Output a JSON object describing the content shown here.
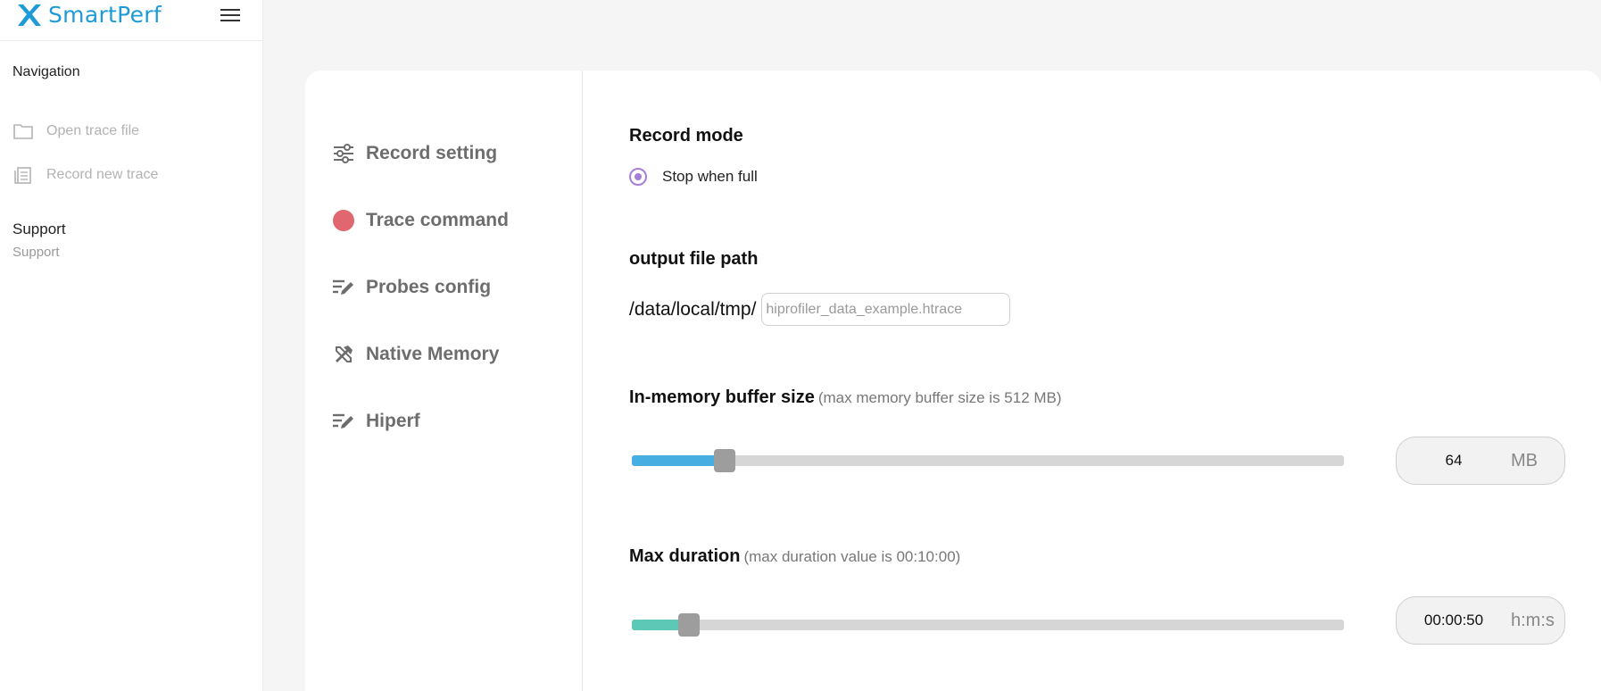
{
  "app": {
    "logo_text": "SmartPerf"
  },
  "sidebar": {
    "navigation_title": "Navigation",
    "items": [
      {
        "label": "Open trace file",
        "icon": "folder-icon"
      },
      {
        "label": "Record new trace",
        "icon": "copy-icon"
      }
    ],
    "support_title": "Support",
    "support_sub": "Support"
  },
  "settings_menu": [
    {
      "label": "Record setting",
      "icon": "sliders-icon"
    },
    {
      "label": "Trace command",
      "icon": "record-dot-icon"
    },
    {
      "label": "Probes config",
      "icon": "edit-icon"
    },
    {
      "label": "Native Memory",
      "icon": "tools-icon"
    },
    {
      "label": "Hiperf",
      "icon": "edit-icon"
    }
  ],
  "record_mode": {
    "title": "Record mode",
    "option_label": "Stop when full",
    "selected": true
  },
  "output_path": {
    "title": "output file path",
    "prefix": "/data/local/tmp/",
    "placeholder": "hiprofiler_data_example.htrace"
  },
  "buffer_size": {
    "title": "In-memory buffer size",
    "note": "(max memory buffer size is 512 MB)",
    "value": "64",
    "unit": "MB",
    "slider_fraction": 0.13,
    "fill_color": "#46aee0"
  },
  "max_duration": {
    "title": "Max duration",
    "note": "(max duration value is 00:10:00)",
    "value": "00:00:50",
    "unit": "h:m:s",
    "slider_fraction": 0.08,
    "fill_color": "#5cc8b5"
  },
  "colors": {
    "accent": "#a77fd8",
    "logo": "#1e9bd7",
    "record_dot": "#e0666f"
  }
}
